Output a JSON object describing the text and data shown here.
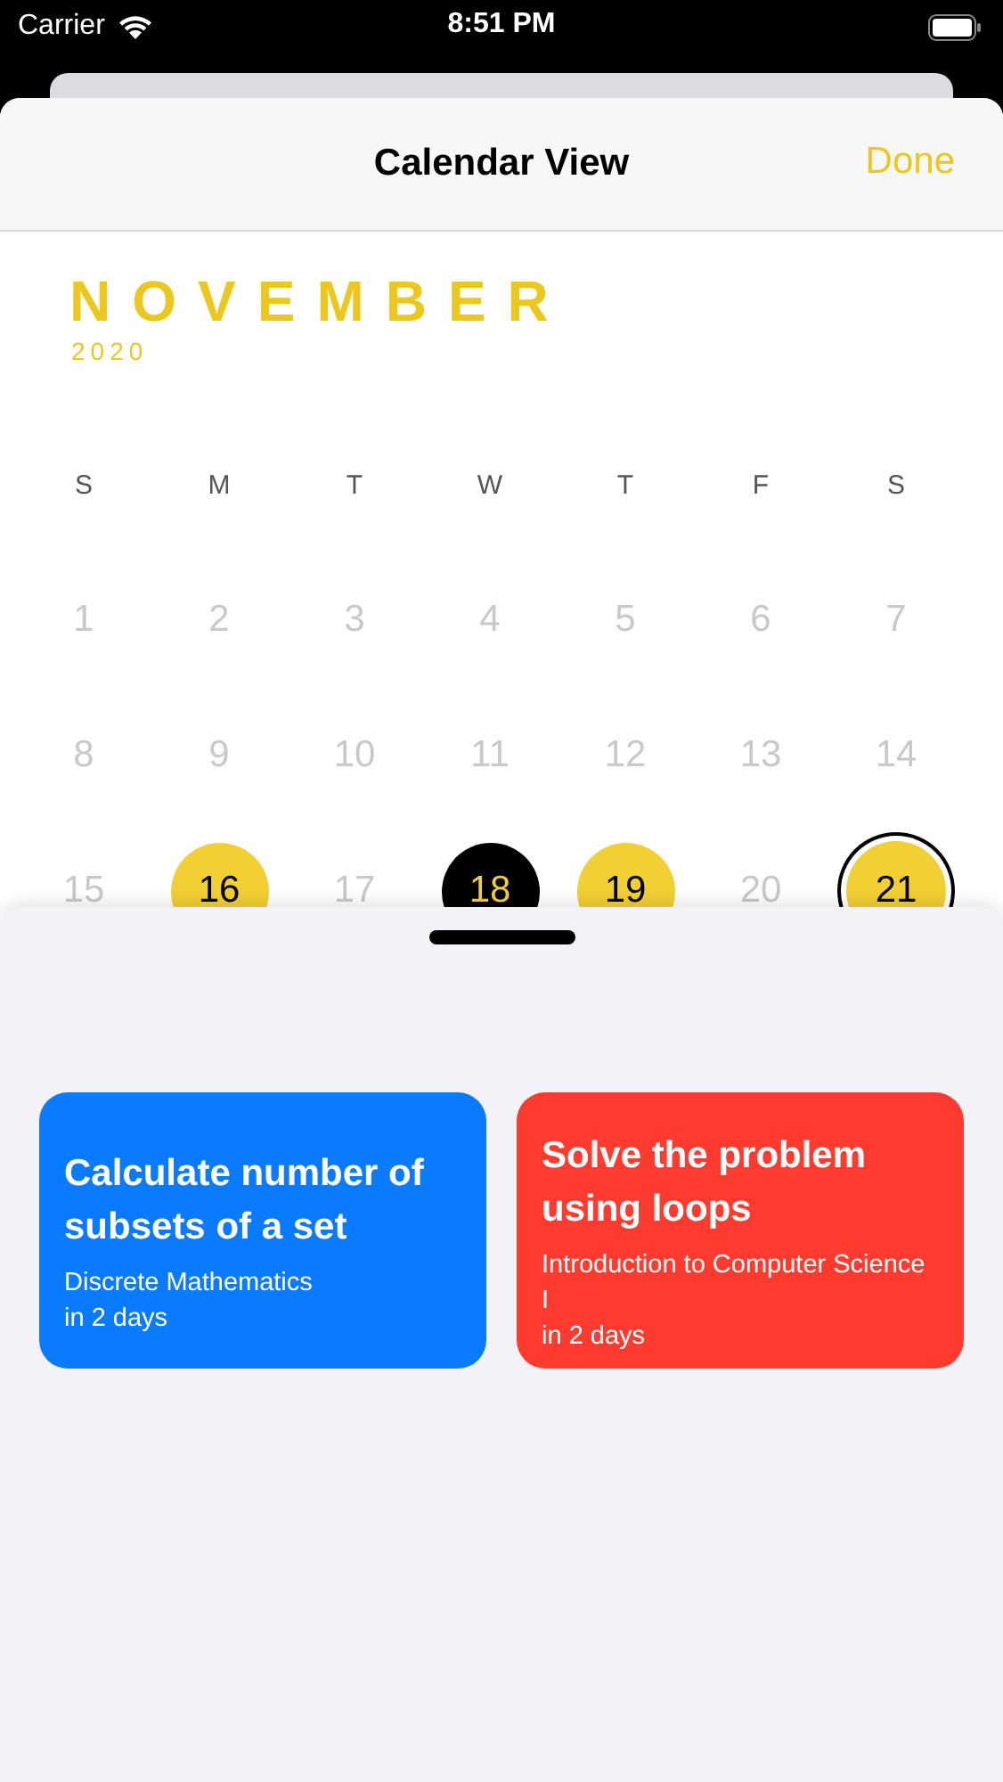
{
  "status_bar": {
    "carrier": "Carrier",
    "time": "8:51 PM"
  },
  "nav": {
    "title": "Calendar View",
    "done": "Done"
  },
  "calendar": {
    "month": "NOVEMBER",
    "year": "2020",
    "weekdays": [
      "S",
      "M",
      "T",
      "W",
      "T",
      "F",
      "S"
    ],
    "weeks": [
      [
        {
          "label": "1",
          "event": false,
          "today": false,
          "selected": false
        },
        {
          "label": "2",
          "event": false,
          "today": false,
          "selected": false
        },
        {
          "label": "3",
          "event": false,
          "today": false,
          "selected": false
        },
        {
          "label": "4",
          "event": false,
          "today": false,
          "selected": false
        },
        {
          "label": "5",
          "event": false,
          "today": false,
          "selected": false
        },
        {
          "label": "6",
          "event": false,
          "today": false,
          "selected": false
        },
        {
          "label": "7",
          "event": false,
          "today": false,
          "selected": false
        }
      ],
      [
        {
          "label": "8",
          "event": false,
          "today": false,
          "selected": false
        },
        {
          "label": "9",
          "event": false,
          "today": false,
          "selected": false
        },
        {
          "label": "10",
          "event": false,
          "today": false,
          "selected": false
        },
        {
          "label": "11",
          "event": false,
          "today": false,
          "selected": false
        },
        {
          "label": "12",
          "event": false,
          "today": false,
          "selected": false
        },
        {
          "label": "13",
          "event": false,
          "today": false,
          "selected": false
        },
        {
          "label": "14",
          "event": false,
          "today": false,
          "selected": false
        }
      ],
      [
        {
          "label": "15",
          "event": false,
          "today": false,
          "selected": false
        },
        {
          "label": "16",
          "event": true,
          "today": false,
          "selected": false
        },
        {
          "label": "17",
          "event": false,
          "today": false,
          "selected": false
        },
        {
          "label": "18",
          "event": true,
          "today": true,
          "selected": false
        },
        {
          "label": "19",
          "event": true,
          "today": false,
          "selected": false
        },
        {
          "label": "20",
          "event": false,
          "today": false,
          "selected": false
        },
        {
          "label": "21",
          "event": true,
          "today": false,
          "selected": true
        }
      ]
    ]
  },
  "tasks": [
    {
      "title": "Calculate number of subsets of a set",
      "course": "Discrete Mathematics",
      "due": "in 2 days",
      "color": "#0a7aff"
    },
    {
      "title": "Solve the problem using loops",
      "course": "Introduction to Computer Science I",
      "due": "in 2 days",
      "color": "#ff3b30"
    }
  ]
}
